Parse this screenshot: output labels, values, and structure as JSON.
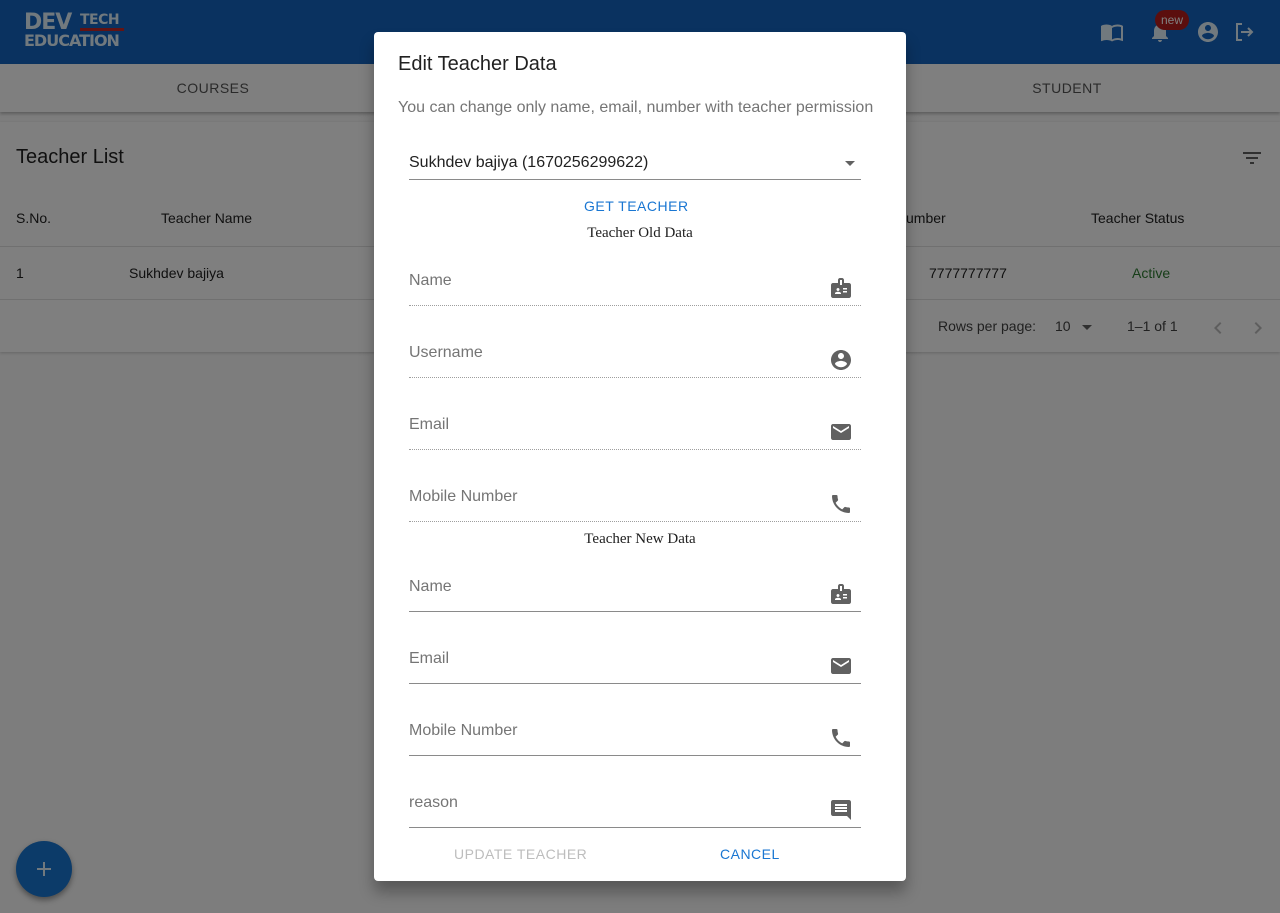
{
  "appbar": {
    "logo_line1": "DEV",
    "logo_line1b": "TECH",
    "logo_line2": "EDUCATION",
    "badge": "new",
    "icons": [
      "book-open-icon",
      "bell-icon",
      "account-circle-icon",
      "logout-icon"
    ],
    "color": "#1565c0"
  },
  "tabs": [
    {
      "label": "COURSES"
    },
    {
      "label": "STUDENT"
    }
  ],
  "teacher_list": {
    "title": "Teacher List",
    "columns": {
      "sno": "S.No.",
      "name": "Teacher Name",
      "number": "umber",
      "status": "Teacher Status"
    },
    "rows": [
      {
        "sno": "1",
        "name": "Sukhdev bajiya",
        "number": "7777777777",
        "status": "Active"
      }
    ],
    "pagination": {
      "rows_per_page_label": "Rows per page:",
      "rows_per_page_value": "10",
      "range": "1–1 of 1"
    }
  },
  "fab": {
    "label": "+"
  },
  "dialog": {
    "title": "Edit Teacher Data",
    "description": "You can change only name, email, number with teacher permission",
    "teacher_select": {
      "value": "Sukhdev bajiya (1670256299622)"
    },
    "get_teacher_label": "GET TEACHER",
    "old_section_label": "Teacher Old Data",
    "old_fields": {
      "name": "Name",
      "username": "Username",
      "email": "Email",
      "mobile": "Mobile Number"
    },
    "new_section_label": "Teacher New Data",
    "new_fields": {
      "name": "Name",
      "email": "Email",
      "mobile": "Mobile Number",
      "reason": "reason"
    },
    "update_label": "UPDATE TEACHER",
    "cancel_label": "CANCEL"
  },
  "colors": {
    "primary": "#1976d2",
    "active_status": "#2e7d32",
    "badge": "#b71c1c"
  }
}
